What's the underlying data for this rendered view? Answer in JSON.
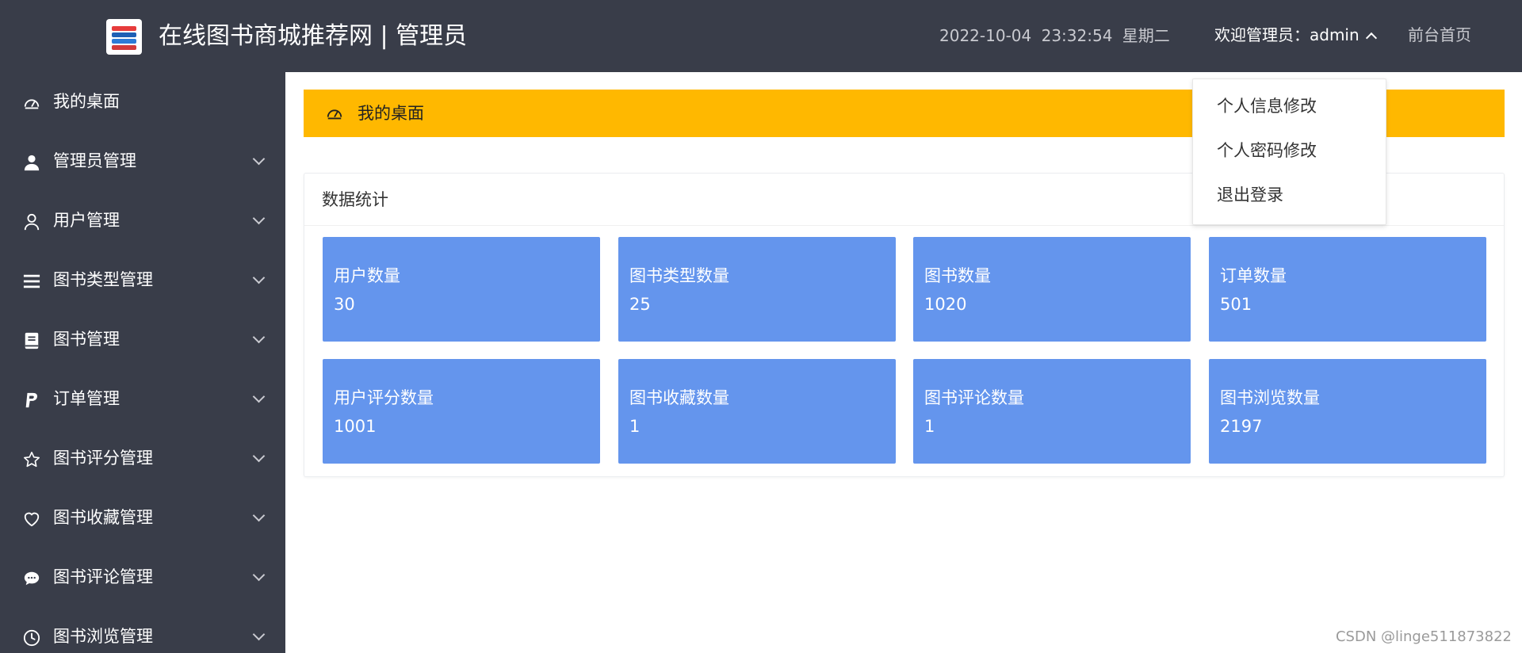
{
  "header": {
    "title": "在线图书商城推荐网 | 管理员",
    "datetime": "2022-10-04  23:32:54  星期二",
    "welcome": "欢迎管理员：admin",
    "front_link": "前台首页",
    "logo_icon": "books-logo-icon"
  },
  "sidebar": {
    "items": [
      {
        "label": "我的桌面",
        "icon": "dashboard-icon",
        "has_caret": false
      },
      {
        "label": "管理员管理",
        "icon": "user-solid-icon",
        "has_caret": true
      },
      {
        "label": "用户管理",
        "icon": "user-outline-icon",
        "has_caret": true
      },
      {
        "label": "图书类型管理",
        "icon": "list-icon",
        "has_caret": true
      },
      {
        "label": "图书管理",
        "icon": "book-icon",
        "has_caret": true
      },
      {
        "label": "订单管理",
        "icon": "paypal-icon",
        "has_caret": true
      },
      {
        "label": "图书评分管理",
        "icon": "star-icon",
        "has_caret": true
      },
      {
        "label": "图书收藏管理",
        "icon": "heart-icon",
        "has_caret": true
      },
      {
        "label": "图书评论管理",
        "icon": "comment-icon",
        "has_caret": true
      },
      {
        "label": "图书浏览管理",
        "icon": "clock-icon",
        "has_caret": true
      }
    ]
  },
  "breadcrumb": {
    "label": "我的桌面"
  },
  "stats_panel": {
    "title": "数据统计",
    "cards": [
      {
        "title": "用户数量",
        "value": "30"
      },
      {
        "title": "图书类型数量",
        "value": "25"
      },
      {
        "title": "图书数量",
        "value": "1020"
      },
      {
        "title": "订单数量",
        "value": "501"
      },
      {
        "title": "用户评分数量",
        "value": "1001"
      },
      {
        "title": "图书收藏数量",
        "value": "1"
      },
      {
        "title": "图书评论数量",
        "value": "1"
      },
      {
        "title": "图书浏览数量",
        "value": "2197"
      }
    ]
  },
  "dropdown": {
    "items": [
      {
        "label": "个人信息修改"
      },
      {
        "label": "个人密码修改"
      },
      {
        "label": "退出登录"
      }
    ]
  },
  "watermark": "CSDN @linge511873822",
  "colors": {
    "header_bg": "#393d49",
    "sidebar_bg": "#393d49",
    "breadcrumb_bg": "#ffb800",
    "card_bg": "#6495ed"
  }
}
